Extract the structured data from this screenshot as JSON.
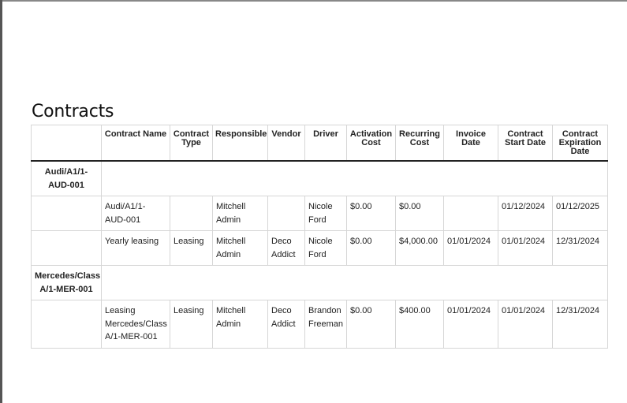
{
  "page": {
    "title": "Contracts"
  },
  "table": {
    "headers": [
      "",
      "Contract Name",
      "Contract Type",
      "Responsible",
      "Vendor",
      "Driver",
      "Activation Cost",
      "Recurring Cost",
      "Invoice Date",
      "Contract Start Date",
      "Contract Expiration Date"
    ],
    "groups": [
      {
        "name": "Audi/A1/1-AUD-001",
        "rows": [
          {
            "contract_name": "Audi/A1/1-AUD-001",
            "contract_type": "",
            "responsible": "Mitchell Admin",
            "vendor": "",
            "driver": "Nicole Ford",
            "activation_cost": "$0.00",
            "recurring_cost": "$0.00",
            "invoice_date": "",
            "start_date": "01/12/2024",
            "expiration_date": "01/12/2025"
          },
          {
            "contract_name": "Yearly leasing",
            "contract_type": "Leasing",
            "responsible": "Mitchell Admin",
            "vendor": "Deco Addict",
            "driver": "Nicole Ford",
            "activation_cost": "$0.00",
            "recurring_cost": "$4,000.00",
            "invoice_date": "01/01/2024",
            "start_date": "01/01/2024",
            "expiration_date": "12/31/2024"
          }
        ]
      },
      {
        "name": "Mercedes/Class A/1-MER-001",
        "rows": [
          {
            "contract_name": "Leasing Mercedes/Class A/1-MER-001",
            "contract_type": "Leasing",
            "responsible": "Mitchell Admin",
            "vendor": "Deco Addict",
            "driver": "Brandon Freeman",
            "activation_cost": "$0.00",
            "recurring_cost": "$400.00",
            "invoice_date": "01/01/2024",
            "start_date": "01/01/2024",
            "expiration_date": "12/31/2024"
          }
        ]
      }
    ]
  }
}
